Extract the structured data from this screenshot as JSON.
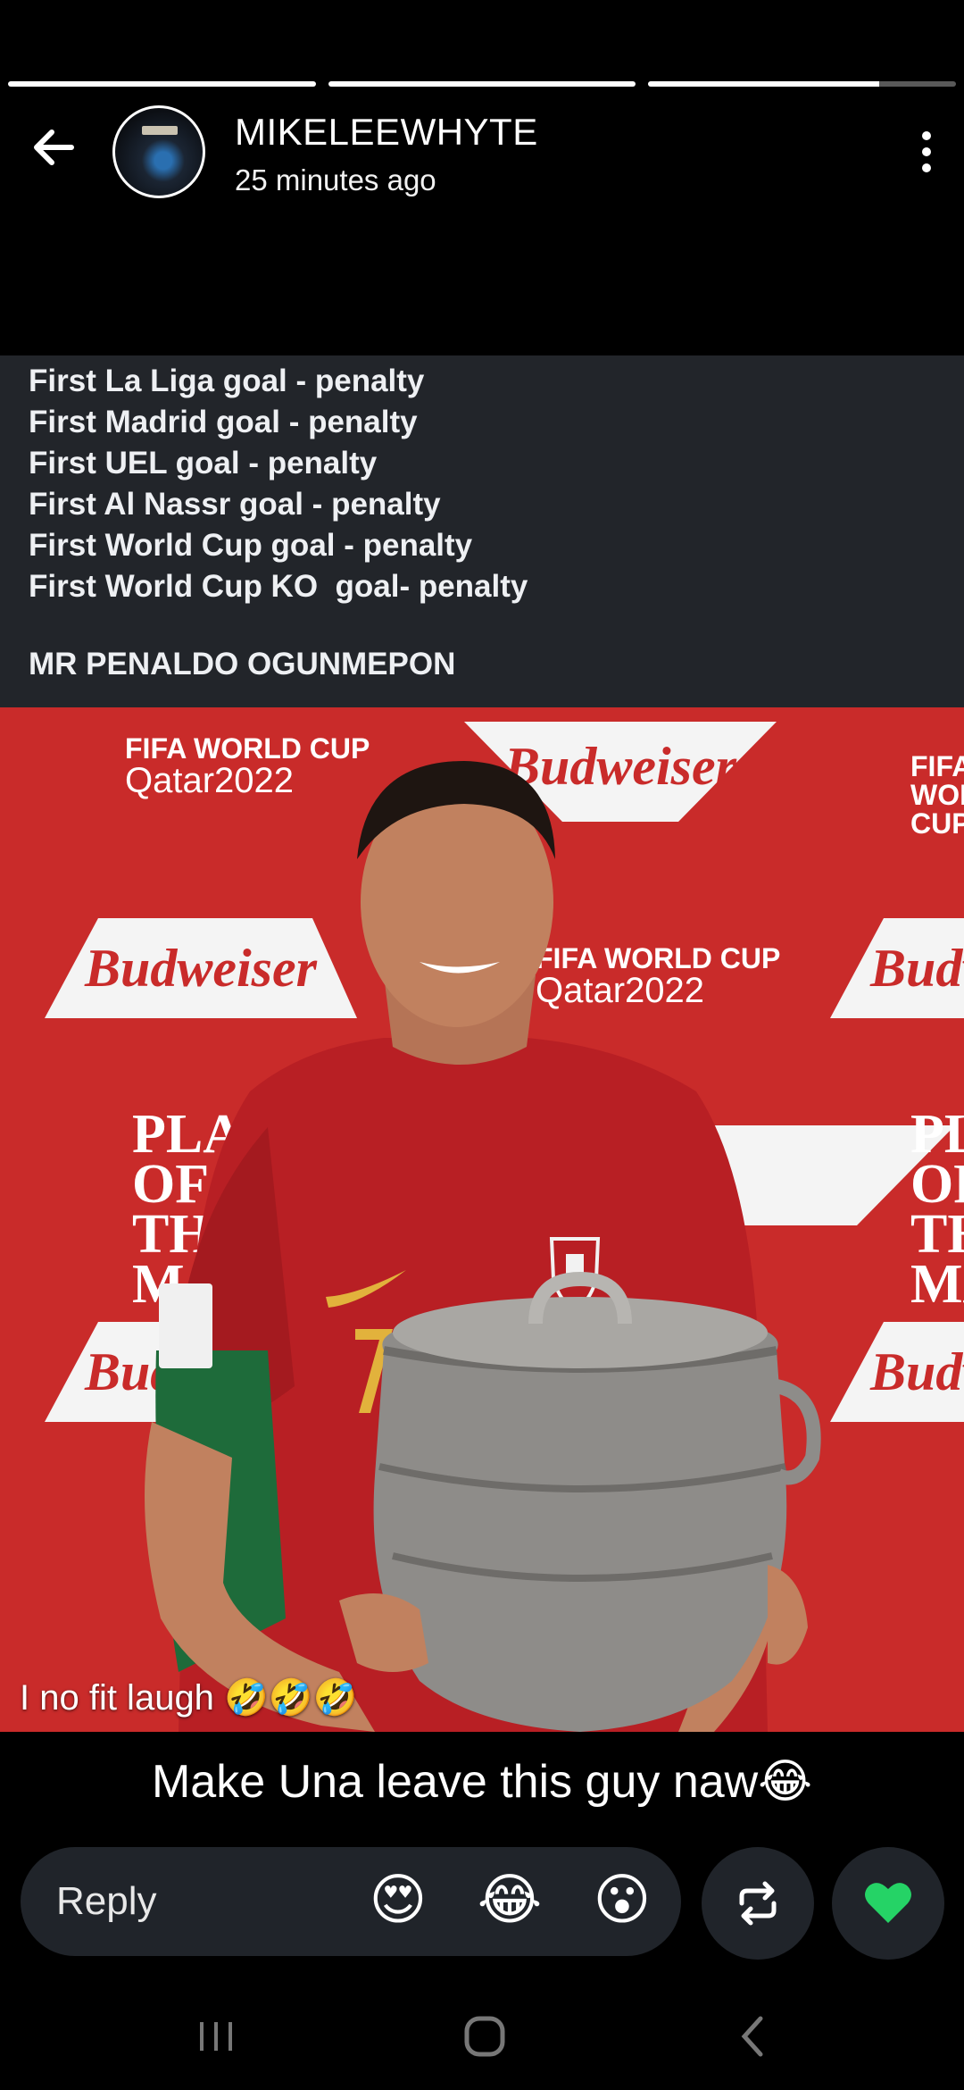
{
  "story": {
    "progress": [
      1.0,
      1.0,
      0.75
    ]
  },
  "header": {
    "username": "MIKELEEWHYTE",
    "time": "25 minutes ago"
  },
  "post": {
    "caption_lines": [
      "First La Liga goal - penalty",
      "First Madrid goal - penalty",
      "First UEL goal - penalty",
      "First Al Nassr goal - penalty",
      "First World Cup goal - penalty",
      "First World Cup KO  goal- penalty"
    ],
    "caption_sign": "MR PENALDO OGUNMEPON",
    "overlay_caption": "I no fit laugh 🤣🤣🤣",
    "backdrop": {
      "fifa_line1": "FIFA WORLD CUP",
      "fifa_line2": "Qatar2022",
      "brand": "Budweiser",
      "award": "PLAYER OF THE MATCH"
    }
  },
  "reply_text": "Make Una leave this guy naw😂",
  "actions": {
    "reply_label": "Reply",
    "reactions": [
      "😍",
      "😂",
      "😮"
    ],
    "repost_icon": "repost-icon",
    "like_icon": "heart-icon",
    "like_color": "#25d366"
  },
  "colors": {
    "background": "#000000",
    "caption_bg": "#22252a",
    "photo_bg": "#c92b2a",
    "control_bg": "#20242a"
  }
}
